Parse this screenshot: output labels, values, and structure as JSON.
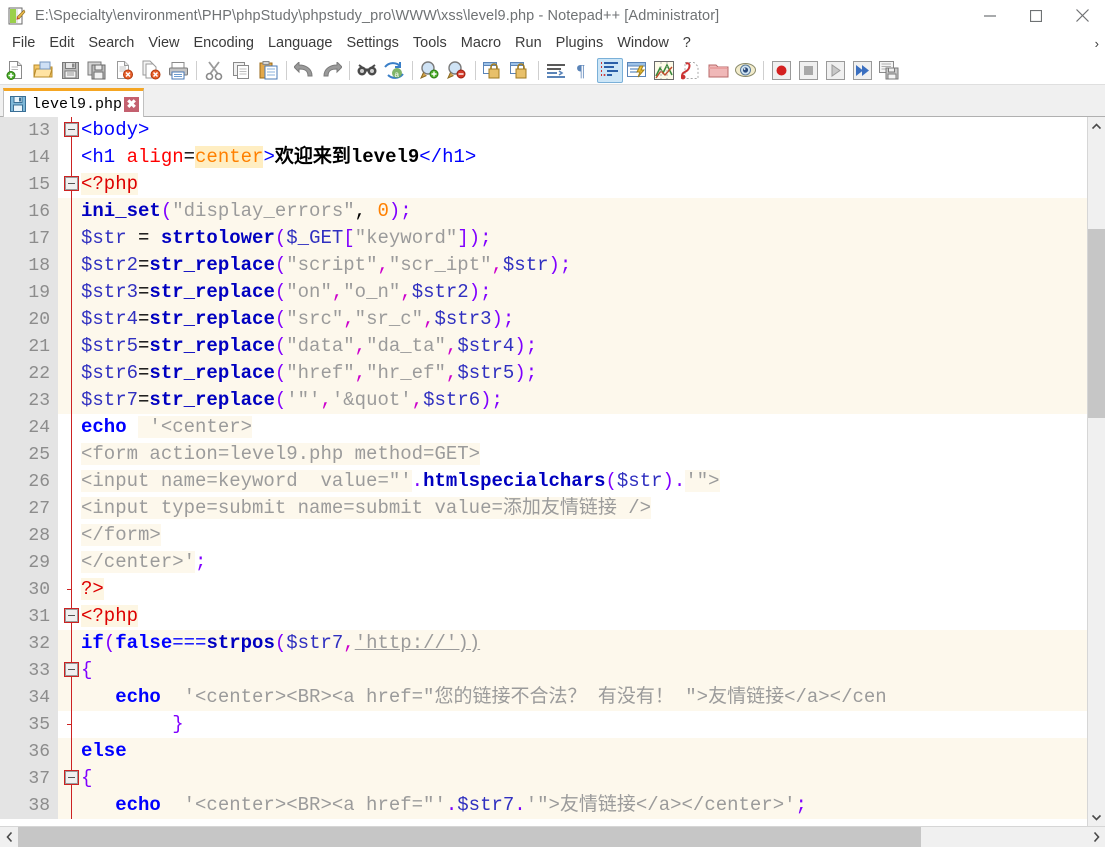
{
  "window": {
    "title": "E:\\Specialty\\environment\\PHP\\phpStudy\\phpstudy_pro\\WWW\\xss\\level9.php - Notepad++ [Administrator]",
    "app_icon": "notepad-plus-plus-icon",
    "minimize_label": "—",
    "maximize_label": "□",
    "close_label": "✕"
  },
  "menubar": {
    "items": [
      {
        "label": "File",
        "name": "menu-file"
      },
      {
        "label": "Edit",
        "name": "menu-edit"
      },
      {
        "label": "Search",
        "name": "menu-search"
      },
      {
        "label": "View",
        "name": "menu-view"
      },
      {
        "label": "Encoding",
        "name": "menu-encoding"
      },
      {
        "label": "Language",
        "name": "menu-language"
      },
      {
        "label": "Settings",
        "name": "menu-settings"
      },
      {
        "label": "Tools",
        "name": "menu-tools"
      },
      {
        "label": "Macro",
        "name": "menu-macro"
      },
      {
        "label": "Run",
        "name": "menu-run"
      },
      {
        "label": "Plugins",
        "name": "menu-plugins"
      },
      {
        "label": "Window",
        "name": "menu-window"
      },
      {
        "label": "?",
        "name": "menu-help"
      }
    ],
    "overflow_chevron": "›"
  },
  "toolbar": {
    "buttons": [
      {
        "name": "new-file-icon",
        "title": "New"
      },
      {
        "name": "open-file-icon",
        "title": "Open"
      },
      {
        "name": "save-icon",
        "title": "Save"
      },
      {
        "name": "save-all-icon",
        "title": "Save All"
      },
      {
        "name": "close-file-icon",
        "title": "Close"
      },
      {
        "name": "close-all-files-icon",
        "title": "Close All"
      },
      {
        "name": "print-icon",
        "title": "Print"
      },
      {
        "name": "separator-1",
        "title": ""
      },
      {
        "name": "cut-icon",
        "title": "Cut"
      },
      {
        "name": "copy-icon",
        "title": "Copy"
      },
      {
        "name": "paste-icon",
        "title": "Paste"
      },
      {
        "name": "separator-2",
        "title": ""
      },
      {
        "name": "undo-icon",
        "title": "Undo"
      },
      {
        "name": "redo-icon",
        "title": "Redo"
      },
      {
        "name": "separator-3",
        "title": ""
      },
      {
        "name": "find-icon",
        "title": "Find"
      },
      {
        "name": "replace-icon",
        "title": "Replace"
      },
      {
        "name": "separator-4",
        "title": ""
      },
      {
        "name": "zoom-in-icon",
        "title": "Zoom In"
      },
      {
        "name": "zoom-out-icon",
        "title": "Zoom Out"
      },
      {
        "name": "separator-5",
        "title": ""
      },
      {
        "name": "sync-vertical-scroll-icon",
        "title": "Synchronize Vertical Scrolling"
      },
      {
        "name": "sync-horizontal-scroll-icon",
        "title": "Synchronize Horizontal Scrolling"
      },
      {
        "name": "separator-6",
        "title": ""
      },
      {
        "name": "word-wrap-icon",
        "title": "Word Wrap"
      },
      {
        "name": "show-all-characters-icon",
        "title": "Show All Characters"
      },
      {
        "name": "show-indent-guide-icon",
        "title": "Show Indent Guide",
        "selected": true
      },
      {
        "name": "user-defined-language-icon",
        "title": "User Defined Dialogue"
      },
      {
        "name": "document-map-icon",
        "title": "Document Map"
      },
      {
        "name": "function-list-icon",
        "title": "Function List"
      },
      {
        "name": "folder-workspace-icon",
        "title": "Folder as Workspace"
      },
      {
        "name": "monitoring-icon",
        "title": "Monitoring"
      },
      {
        "name": "separator-7",
        "title": ""
      },
      {
        "name": "record-macro-icon",
        "title": "Start Recording"
      },
      {
        "name": "stop-macro-icon",
        "title": "Stop Recording"
      },
      {
        "name": "play-macro-icon",
        "title": "Playback"
      },
      {
        "name": "run-macro-multiple-icon",
        "title": "Run a Macro Multiple Times"
      },
      {
        "name": "save-macro-icon",
        "title": "Save Currently Recorded Macro"
      }
    ]
  },
  "tabs": [
    {
      "label": "level9.php",
      "icon": "save-blue-icon",
      "close_label": "✖",
      "active": true
    }
  ],
  "editor": {
    "first_line": 13,
    "lines": [
      {
        "num": "13",
        "fold": "open",
        "vline": false,
        "strbg": false,
        "segs": [
          {
            "t": "<body>",
            "c": "t-tag"
          }
        ]
      },
      {
        "num": "14",
        "fold": "none",
        "vline": true,
        "strbg": false,
        "segs": [
          {
            "t": "<h1 ",
            "c": "t-tag"
          },
          {
            "t": "align",
            "c": "t-attr"
          },
          {
            "t": "=",
            "c": "t-plain"
          },
          {
            "t": "center",
            "c": "t-attrval"
          },
          {
            "t": ">",
            "c": "t-tag"
          },
          {
            "t": "欢迎来到level9",
            "c": "t-text"
          },
          {
            "t": "</h1>",
            "c": "t-tag"
          }
        ]
      },
      {
        "num": "15",
        "fold": "open",
        "vline": false,
        "strbg": false,
        "segs": [
          {
            "t": "<?php",
            "c": "t-php"
          }
        ]
      },
      {
        "num": "16",
        "fold": "none",
        "vline": true,
        "strbg": true,
        "segs": [
          {
            "t": "ini_set",
            "c": "t-fn"
          },
          {
            "t": "(",
            "c": "t-punc"
          },
          {
            "t": "\"display_errors\"",
            "c": "t-str"
          },
          {
            "t": ", ",
            "c": "t-plain"
          },
          {
            "t": "0",
            "c": "t-num"
          },
          {
            "t": ")",
            "c": "t-punc"
          },
          {
            "t": ";",
            "c": "t-punc"
          }
        ]
      },
      {
        "num": "17",
        "fold": "none",
        "vline": true,
        "strbg": true,
        "segs": [
          {
            "t": "$str ",
            "c": "t-var"
          },
          {
            "t": "= ",
            "c": "t-plain"
          },
          {
            "t": "strtolower",
            "c": "t-fn"
          },
          {
            "t": "(",
            "c": "t-punc"
          },
          {
            "t": "$_GET",
            "c": "t-var"
          },
          {
            "t": "[",
            "c": "t-punc"
          },
          {
            "t": "\"keyword\"",
            "c": "t-str"
          },
          {
            "t": "])",
            "c": "t-punc"
          },
          {
            "t": ";",
            "c": "t-punc"
          }
        ]
      },
      {
        "num": "18",
        "fold": "none",
        "vline": true,
        "strbg": true,
        "segs": [
          {
            "t": "$str2",
            "c": "t-var"
          },
          {
            "t": "=",
            "c": "t-plain"
          },
          {
            "t": "str_replace",
            "c": "t-fn"
          },
          {
            "t": "(",
            "c": "t-punc"
          },
          {
            "t": "\"script\"",
            "c": "t-str"
          },
          {
            "t": ",",
            "c": "t-comma"
          },
          {
            "t": "\"scr_ipt\"",
            "c": "t-str"
          },
          {
            "t": ",",
            "c": "t-comma"
          },
          {
            "t": "$str",
            "c": "t-var"
          },
          {
            "t": ")",
            "c": "t-punc"
          },
          {
            "t": ";",
            "c": "t-punc"
          }
        ]
      },
      {
        "num": "19",
        "fold": "none",
        "vline": true,
        "strbg": true,
        "segs": [
          {
            "t": "$str3",
            "c": "t-var"
          },
          {
            "t": "=",
            "c": "t-plain"
          },
          {
            "t": "str_replace",
            "c": "t-fn"
          },
          {
            "t": "(",
            "c": "t-punc"
          },
          {
            "t": "\"on\"",
            "c": "t-str"
          },
          {
            "t": ",",
            "c": "t-comma"
          },
          {
            "t": "\"o_n\"",
            "c": "t-str"
          },
          {
            "t": ",",
            "c": "t-comma"
          },
          {
            "t": "$str2",
            "c": "t-var"
          },
          {
            "t": ")",
            "c": "t-punc"
          },
          {
            "t": ";",
            "c": "t-punc"
          }
        ]
      },
      {
        "num": "20",
        "fold": "none",
        "vline": true,
        "strbg": true,
        "segs": [
          {
            "t": "$str4",
            "c": "t-var"
          },
          {
            "t": "=",
            "c": "t-plain"
          },
          {
            "t": "str_replace",
            "c": "t-fn"
          },
          {
            "t": "(",
            "c": "t-punc"
          },
          {
            "t": "\"src\"",
            "c": "t-str"
          },
          {
            "t": ",",
            "c": "t-comma"
          },
          {
            "t": "\"sr_c\"",
            "c": "t-str"
          },
          {
            "t": ",",
            "c": "t-comma"
          },
          {
            "t": "$str3",
            "c": "t-var"
          },
          {
            "t": ")",
            "c": "t-punc"
          },
          {
            "t": ";",
            "c": "t-punc"
          }
        ]
      },
      {
        "num": "21",
        "fold": "none",
        "vline": true,
        "strbg": true,
        "segs": [
          {
            "t": "$str5",
            "c": "t-var"
          },
          {
            "t": "=",
            "c": "t-plain"
          },
          {
            "t": "str_replace",
            "c": "t-fn"
          },
          {
            "t": "(",
            "c": "t-punc"
          },
          {
            "t": "\"data\"",
            "c": "t-str"
          },
          {
            "t": ",",
            "c": "t-comma"
          },
          {
            "t": "\"da_ta\"",
            "c": "t-str"
          },
          {
            "t": ",",
            "c": "t-comma"
          },
          {
            "t": "$str4",
            "c": "t-var"
          },
          {
            "t": ")",
            "c": "t-punc"
          },
          {
            "t": ";",
            "c": "t-punc"
          }
        ]
      },
      {
        "num": "22",
        "fold": "none",
        "vline": true,
        "strbg": true,
        "segs": [
          {
            "t": "$str6",
            "c": "t-var"
          },
          {
            "t": "=",
            "c": "t-plain"
          },
          {
            "t": "str_replace",
            "c": "t-fn"
          },
          {
            "t": "(",
            "c": "t-punc"
          },
          {
            "t": "\"href\"",
            "c": "t-str"
          },
          {
            "t": ",",
            "c": "t-comma"
          },
          {
            "t": "\"hr_ef\"",
            "c": "t-str"
          },
          {
            "t": ",",
            "c": "t-comma"
          },
          {
            "t": "$str5",
            "c": "t-var"
          },
          {
            "t": ")",
            "c": "t-punc"
          },
          {
            "t": ";",
            "c": "t-punc"
          }
        ]
      },
      {
        "num": "23",
        "fold": "none",
        "vline": true,
        "strbg": true,
        "segs": [
          {
            "t": "$str7",
            "c": "t-var"
          },
          {
            "t": "=",
            "c": "t-plain"
          },
          {
            "t": "str_replace",
            "c": "t-fn"
          },
          {
            "t": "(",
            "c": "t-punc"
          },
          {
            "t": "'\"'",
            "c": "t-str"
          },
          {
            "t": ",",
            "c": "t-comma"
          },
          {
            "t": "'&quot'",
            "c": "t-str"
          },
          {
            "t": ",",
            "c": "t-comma"
          },
          {
            "t": "$str6",
            "c": "t-var"
          },
          {
            "t": ")",
            "c": "t-punc"
          },
          {
            "t": ";",
            "c": "t-punc"
          }
        ]
      },
      {
        "num": "24",
        "fold": "none",
        "vline": true,
        "strbg": false,
        "segs": [
          {
            "t": "echo ",
            "c": "t-kw"
          },
          {
            "t": " '<center>",
            "c": "t-str bg-str"
          }
        ]
      },
      {
        "num": "25",
        "fold": "none",
        "vline": true,
        "strbg": false,
        "segs": [
          {
            "t": "<form action=level9.php method=GET>",
            "c": "t-str bg-str"
          }
        ]
      },
      {
        "num": "26",
        "fold": "none",
        "vline": true,
        "strbg": false,
        "segs": [
          {
            "t": "<input name=keyword  value=\"'",
            "c": "t-str bg-str"
          },
          {
            "t": ".",
            "c": "t-punc"
          },
          {
            "t": "htmlspecialchars",
            "c": "t-fn"
          },
          {
            "t": "(",
            "c": "t-punc"
          },
          {
            "t": "$str",
            "c": "t-var"
          },
          {
            "t": ")",
            "c": "t-punc"
          },
          {
            "t": ".",
            "c": "t-punc"
          },
          {
            "t": "'\">",
            "c": "t-str bg-str"
          }
        ]
      },
      {
        "num": "27",
        "fold": "none",
        "vline": true,
        "strbg": false,
        "segs": [
          {
            "t": "<input type=submit name=submit value=添加友情链接 />",
            "c": "t-str bg-str"
          }
        ]
      },
      {
        "num": "28",
        "fold": "none",
        "vline": true,
        "strbg": false,
        "segs": [
          {
            "t": "</form>",
            "c": "t-str bg-str"
          }
        ]
      },
      {
        "num": "29",
        "fold": "none",
        "vline": true,
        "strbg": false,
        "segs": [
          {
            "t": "</center>'",
            "c": "t-str bg-str"
          },
          {
            "t": ";",
            "c": "t-punc"
          }
        ]
      },
      {
        "num": "30",
        "fold": "end",
        "vline": false,
        "strbg": false,
        "segs": [
          {
            "t": "?>",
            "c": "t-php"
          }
        ]
      },
      {
        "num": "31",
        "fold": "open",
        "vline": false,
        "strbg": false,
        "segs": [
          {
            "t": "<?php",
            "c": "t-php"
          }
        ]
      },
      {
        "num": "32",
        "fold": "none",
        "vline": true,
        "strbg": true,
        "segs": [
          {
            "t": "if",
            "c": "t-kw"
          },
          {
            "t": "(",
            "c": "t-punc"
          },
          {
            "t": "false",
            "c": "t-kw"
          },
          {
            "t": "===",
            "c": "t-op"
          },
          {
            "t": "strpos",
            "c": "t-fn"
          },
          {
            "t": "(",
            "c": "t-punc"
          },
          {
            "t": "$str7",
            "c": "t-var"
          },
          {
            "t": ",",
            "c": "t-comma"
          },
          {
            "t": "'http://'))",
            "c": "t-url"
          }
        ]
      },
      {
        "num": "33",
        "fold": "open",
        "vline": false,
        "strbg": true,
        "segs": [
          {
            "t": "{",
            "c": "t-punc"
          }
        ]
      },
      {
        "num": "34",
        "fold": "none",
        "vline": true,
        "strbg": true,
        "segs": [
          {
            "t": "   echo ",
            "c": "t-kw"
          },
          {
            "t": " '<center><BR><a href=\"您的链接不合法？ 有没有！ \">友情链接</a></cen",
            "c": "t-str"
          }
        ]
      },
      {
        "num": "35",
        "fold": "end",
        "vline": false,
        "strbg": false,
        "segs": [
          {
            "t": "        }",
            "c": "t-punc"
          }
        ]
      },
      {
        "num": "36",
        "fold": "none",
        "vline": true,
        "strbg": true,
        "segs": [
          {
            "t": "else",
            "c": "t-kw"
          }
        ]
      },
      {
        "num": "37",
        "fold": "open",
        "vline": false,
        "strbg": true,
        "segs": [
          {
            "t": "{",
            "c": "t-punc"
          }
        ]
      },
      {
        "num": "38",
        "fold": "none",
        "vline": true,
        "strbg": true,
        "segs": [
          {
            "t": "   echo ",
            "c": "t-kw"
          },
          {
            "t": " '<center><BR><a href=\"'",
            "c": "t-str"
          },
          {
            "t": ".",
            "c": "t-punc"
          },
          {
            "t": "$str7",
            "c": "t-var"
          },
          {
            "t": ".",
            "c": "t-punc"
          },
          {
            "t": "'\">友情链接</a></center>'",
            "c": "t-str"
          },
          {
            "t": ";",
            "c": "t-punc"
          }
        ]
      }
    ]
  },
  "scrollbars": {
    "vertical": {
      "up_arrow": "⌃",
      "down_arrow": "⌄",
      "thumb_top_pct": 14,
      "thumb_height_pct": 28
    },
    "horizontal": {
      "left_arrow": "‹",
      "right_arrow": "›",
      "thumb_width_pct": 84.5
    }
  }
}
